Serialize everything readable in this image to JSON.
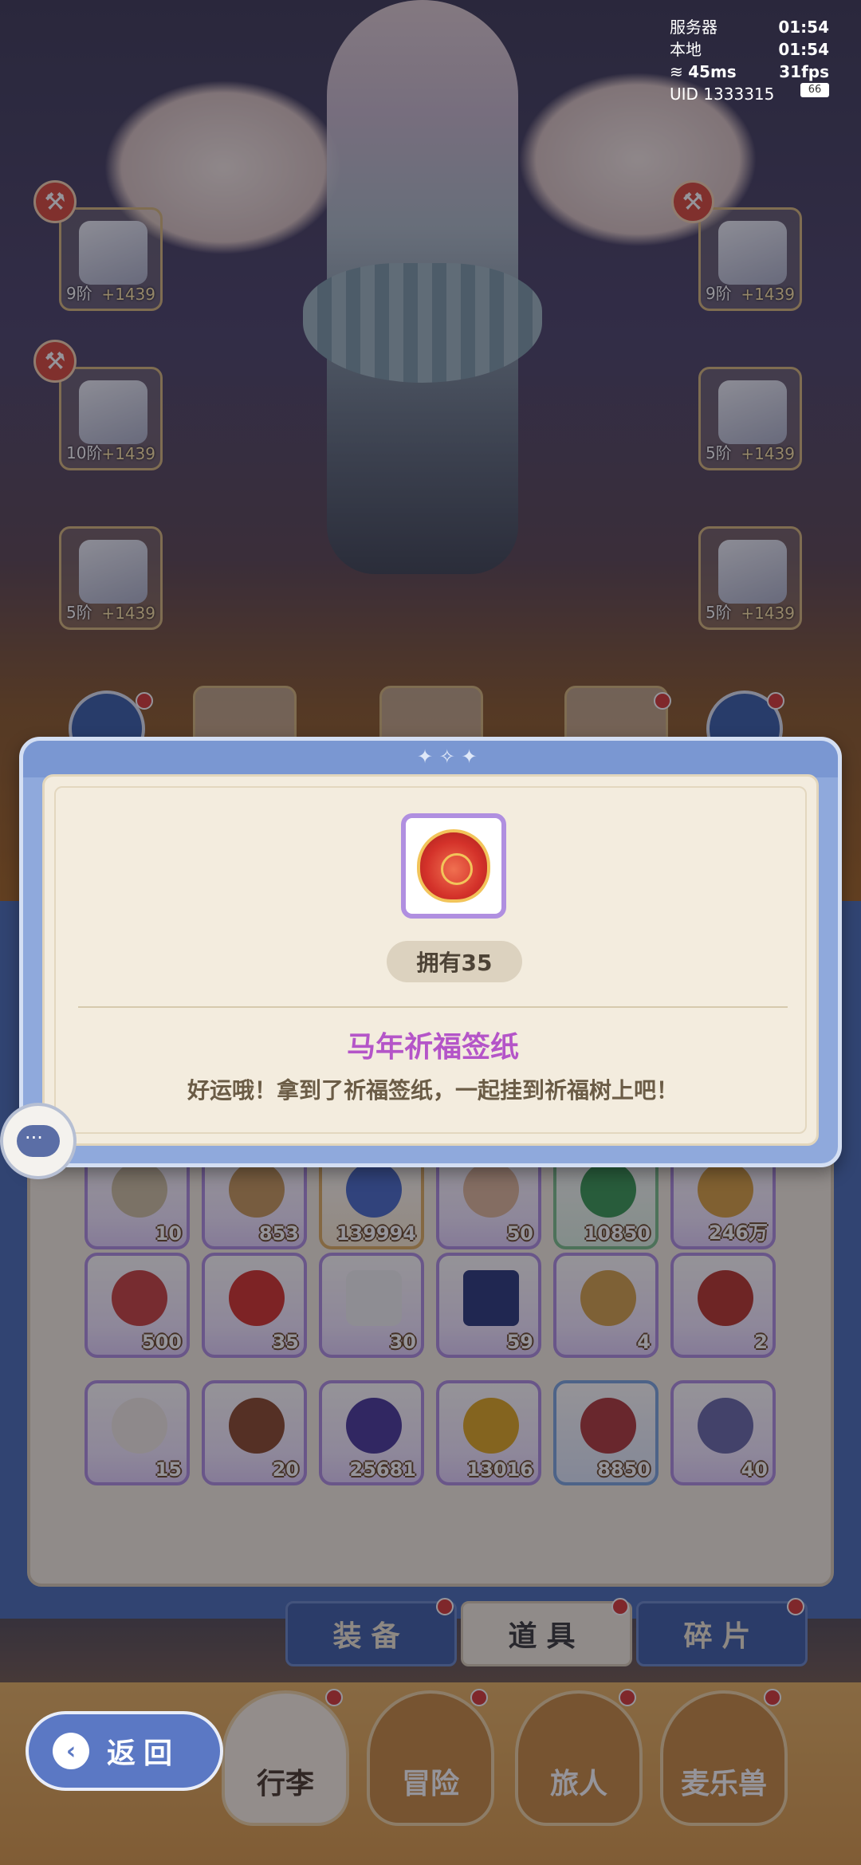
{
  "status": {
    "server_label": "服务器",
    "server_time": "01:54",
    "local_label": "本地",
    "local_time": "01:54",
    "ping": "45ms",
    "fps": "31fps",
    "uid": "UID 1333315",
    "battery": "66"
  },
  "equipment": [
    {
      "level": "9阶",
      "bonus": "+1439"
    },
    {
      "level": "9阶",
      "bonus": "+1439"
    },
    {
      "level": "10阶",
      "bonus": "+1439"
    },
    {
      "level": "5阶",
      "bonus": "+1439"
    },
    {
      "level": "5阶",
      "bonus": "+1439"
    },
    {
      "level": "5阶",
      "bonus": "+1439"
    }
  ],
  "dialog": {
    "owned": "拥有35",
    "item_name": "马年祈福签纸",
    "description": "好运哦！拿到了祈福签纸，一起挂到祈福树上吧！"
  },
  "inventory": {
    "row1": [
      "10",
      "853",
      "139994",
      "50",
      "10850",
      "246万"
    ],
    "row2": [
      "500",
      "35",
      "30",
      "59",
      "4",
      "2"
    ],
    "row3": [
      "15",
      "20",
      "25681",
      "13016",
      "8850",
      "40"
    ]
  },
  "tabs": [
    "装备",
    "道具",
    "碎片"
  ],
  "nav": [
    "行李",
    "冒险",
    "旅人",
    "麦乐兽"
  ],
  "back_label": "返回",
  "colors": {
    "accent": "#b455c8",
    "panel": "#4a6eb6",
    "paper": "#f3ecde"
  }
}
